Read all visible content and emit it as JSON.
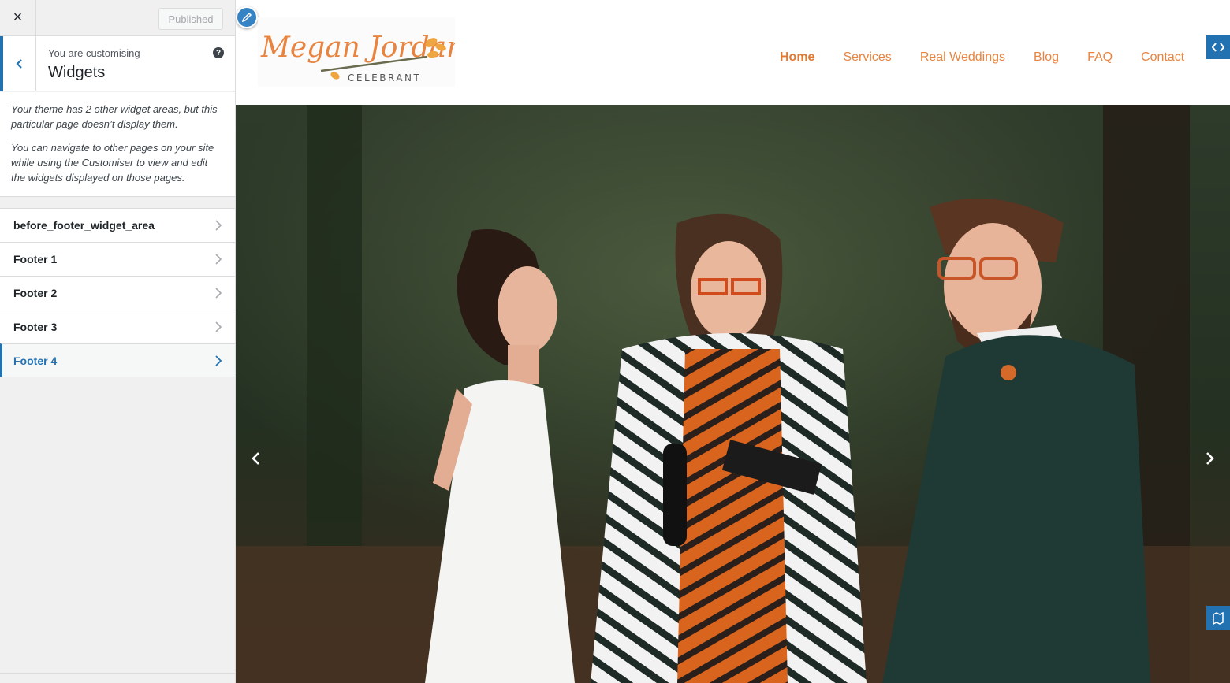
{
  "sidebar": {
    "close_label": "×",
    "publish_button": "Published",
    "customising_label": "You are customising",
    "section_title": "Widgets",
    "help_glyph": "?",
    "notice": [
      "Your theme has 2 other widget areas, but this particular page doesn’t display them.",
      "You can navigate to other pages on your site while using the Customiser to view and edit the widgets displayed on those pages."
    ],
    "widget_areas": [
      {
        "label": "before_footer_widget_area",
        "active": false
      },
      {
        "label": "Footer 1",
        "active": false
      },
      {
        "label": "Footer 2",
        "active": false
      },
      {
        "label": "Footer 3",
        "active": false
      },
      {
        "label": "Footer 4",
        "active": true
      }
    ]
  },
  "site": {
    "logo_name": "Megan Jordan",
    "logo_subtitle": "CELEBRANT",
    "nav": [
      "Home",
      "Services",
      "Real Weddings",
      "Blog",
      "FAQ",
      "Contact"
    ],
    "current_nav": "Home"
  },
  "colors": {
    "accent": "#2271b1",
    "brand_orange": "#e8843f"
  }
}
